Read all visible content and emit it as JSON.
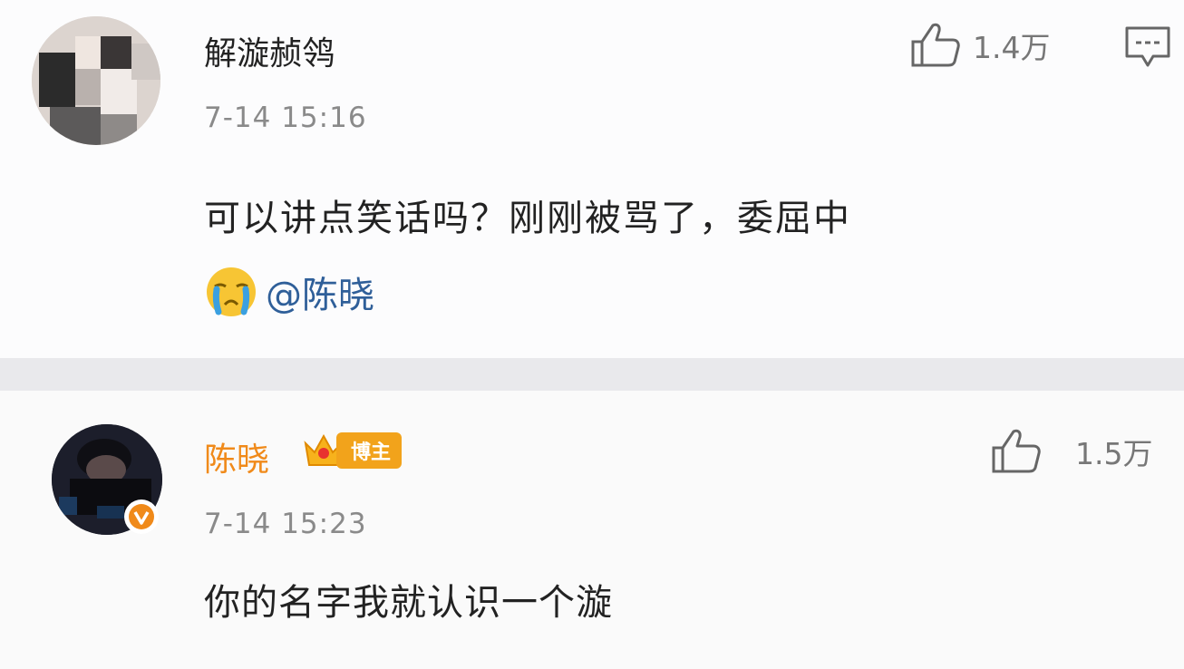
{
  "comments": [
    {
      "user": "解漩赪鸰",
      "time": "7-14 15:16",
      "text": "可以讲点笑话吗？刚刚被骂了，委屈中",
      "mention": "@陈晓",
      "emoji_icon": "crying-face-icon",
      "likes": "1.4万"
    },
    {
      "user": "陈晓",
      "badge": "博主",
      "time": "7-14 15:23",
      "text": "你的名字我就认识一个漩",
      "likes": "1.5万"
    }
  ],
  "colors": {
    "author_name": "#f08a1a",
    "mention": "#2f5f99",
    "badge": "#f2a31b",
    "verified": "#f08a1a"
  }
}
